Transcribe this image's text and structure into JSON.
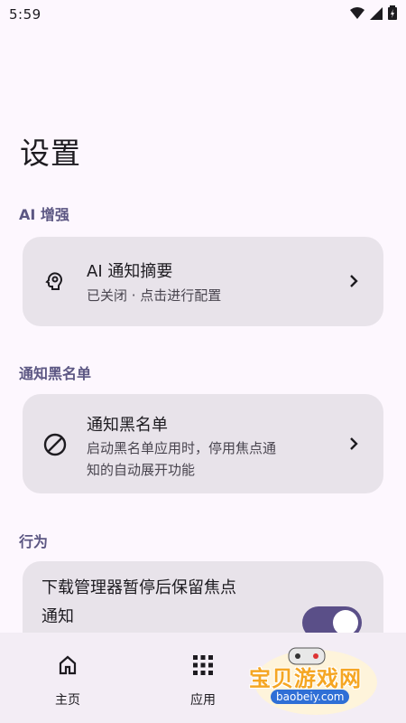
{
  "status_bar": {
    "time": "5:59",
    "icons": [
      "wifi-icon",
      "cellular-icon",
      "battery-charging-icon"
    ]
  },
  "page": {
    "title": "设置"
  },
  "sections": [
    {
      "header": "AI 增强",
      "items": [
        {
          "icon": "ai-brain-icon",
          "title": "AI 通知摘要",
          "subtitle": "已关闭 · 点击进行配置"
        }
      ]
    },
    {
      "header": "通知黑名单",
      "items": [
        {
          "icon": "block-icon",
          "title": "通知黑名单",
          "subtitle_line1": "启动黑名单应用时，停用焦点通",
          "subtitle_line2": "知的自动展开功能"
        }
      ]
    },
    {
      "header": "行为",
      "items": [
        {
          "title_line1": "下载管理器暂停后保留焦点",
          "title_line2": "通知",
          "toggle_on": true
        }
      ]
    }
  ],
  "bottom_nav": [
    {
      "icon": "home-icon",
      "label": "主页"
    },
    {
      "icon": "apps-grid-icon",
      "label": "应用"
    }
  ],
  "watermark": {
    "text": "宝贝游戏网",
    "url": "baobeiy.com"
  },
  "colors": {
    "background": "#fdf7fe",
    "card": "#e8e3ea",
    "section_header": "#5c5783",
    "switch_on": "#5a4f88",
    "nav_bar": "#f3edf5"
  }
}
